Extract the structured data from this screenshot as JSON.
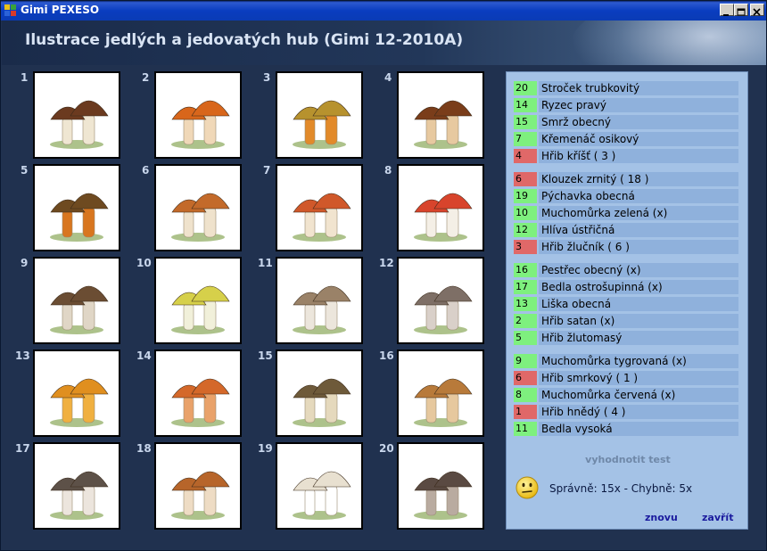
{
  "window": {
    "title": "Gimi PEXESO"
  },
  "header": {
    "title": "Ilustrace jedlých a jedovatých hub (Gimi 12-2010A)"
  },
  "cards": [
    {
      "number": "1",
      "colors": [
        "#6b3a1f",
        "#efe6d2"
      ]
    },
    {
      "number": "2",
      "colors": [
        "#d8661b",
        "#f0d8b8"
      ]
    },
    {
      "number": "3",
      "colors": [
        "#b7922e",
        "#e28a2a"
      ]
    },
    {
      "number": "4",
      "colors": [
        "#7a3d1a",
        "#e7c9a0"
      ]
    },
    {
      "number": "5",
      "colors": [
        "#6e4a20",
        "#d8761f"
      ]
    },
    {
      "number": "6",
      "colors": [
        "#c36a2a",
        "#efe2cc"
      ]
    },
    {
      "number": "7",
      "colors": [
        "#d0582a",
        "#f1e4cf"
      ]
    },
    {
      "number": "8",
      "colors": [
        "#d8442c",
        "#f4efe6"
      ]
    },
    {
      "number": "9",
      "colors": [
        "#6b4d33",
        "#e0d6c6"
      ]
    },
    {
      "number": "10",
      "colors": [
        "#d6d04a",
        "#f1f0da"
      ]
    },
    {
      "number": "11",
      "colors": [
        "#9a8268",
        "#ece6dc"
      ]
    },
    {
      "number": "12",
      "colors": [
        "#7e6f66",
        "#d9d0c9"
      ]
    },
    {
      "number": "13",
      "colors": [
        "#e08f1f",
        "#f0b040"
      ]
    },
    {
      "number": "14",
      "colors": [
        "#d4682a",
        "#e9a26a"
      ]
    },
    {
      "number": "15",
      "colors": [
        "#6e5a3a",
        "#e5d9bd"
      ]
    },
    {
      "number": "16",
      "colors": [
        "#b87a3a",
        "#e6c89e"
      ]
    },
    {
      "number": "17",
      "colors": [
        "#5d5148",
        "#ece5dd"
      ]
    },
    {
      "number": "18",
      "colors": [
        "#b7652a",
        "#eedcc4"
      ]
    },
    {
      "number": "19",
      "colors": [
        "#e8e0d0",
        "#ffffff"
      ]
    },
    {
      "number": "20",
      "colors": [
        "#5a4a42",
        "#b9aba0"
      ]
    }
  ],
  "answers": [
    {
      "num": "20",
      "name": "Stroček trubkovitý",
      "status": "ok"
    },
    {
      "num": "14",
      "name": "Ryzec pravý",
      "status": "ok"
    },
    {
      "num": "15",
      "name": "Smrž obecný",
      "status": "ok"
    },
    {
      "num": "7",
      "name": "Křemenáč osikový",
      "status": "ok"
    },
    {
      "num": "4",
      "name": "Hřib kříšť ( 3 )",
      "status": "bad"
    },
    {
      "num": "6",
      "name": "Klouzek zrnitý ( 18 )",
      "status": "bad"
    },
    {
      "num": "19",
      "name": "Pýchavka obecná",
      "status": "ok"
    },
    {
      "num": "10",
      "name": "Muchomůrka zelená (x)",
      "status": "ok"
    },
    {
      "num": "12",
      "name": "Hlíva ústřičná",
      "status": "ok"
    },
    {
      "num": "3",
      "name": "Hřib žlučník ( 6 )",
      "status": "bad"
    },
    {
      "num": "16",
      "name": "Pestřec obecný (x)",
      "status": "ok"
    },
    {
      "num": "17",
      "name": "Bedla ostrošupinná (x)",
      "status": "ok"
    },
    {
      "num": "13",
      "name": "Liška obecná",
      "status": "ok"
    },
    {
      "num": "2",
      "name": "Hřib satan (x)",
      "status": "ok"
    },
    {
      "num": "5",
      "name": "Hřib žlutomasý",
      "status": "ok"
    },
    {
      "num": "9",
      "name": "Muchomůrka tygrovaná (x)",
      "status": "ok"
    },
    {
      "num": "6",
      "name": "Hřib smrkový ( 1 )",
      "status": "bad"
    },
    {
      "num": "8",
      "name": "Muchomůrka červená (x)",
      "status": "ok"
    },
    {
      "num": "1",
      "name": "Hřib hnědý ( 4 )",
      "status": "bad"
    },
    {
      "num": "11",
      "name": "Bedla vysoká",
      "status": "ok"
    }
  ],
  "panel": {
    "evaluate_label": "vyhodnotit test",
    "score": "Správně: 15x - Chybně: 5x",
    "again_label": "znovu",
    "close_label": "zavřít"
  },
  "colors": {
    "correct": "#7ef07e",
    "wrong": "#e06868"
  }
}
